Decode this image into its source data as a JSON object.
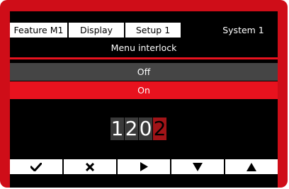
{
  "tabs": [
    {
      "label": "Feature  M1",
      "active": false
    },
    {
      "label": "Display",
      "active": false
    },
    {
      "label": "Setup 1",
      "active": false
    },
    {
      "label": "System 1",
      "active": true
    }
  ],
  "menu": {
    "title": "Menu interlock",
    "options": [
      {
        "label": "Off",
        "selected": false
      },
      {
        "label": "On",
        "selected": true
      }
    ]
  },
  "code": {
    "digits": [
      "1",
      "2",
      "0",
      "2"
    ],
    "selected_index": 3
  },
  "softkeys": [
    {
      "icon": "checkmark-icon"
    },
    {
      "icon": "close-icon"
    },
    {
      "icon": "arrow-right-icon"
    },
    {
      "icon": "arrow-down-icon"
    },
    {
      "icon": "arrow-up-icon"
    }
  ],
  "colors": {
    "frame_red": "#cf0d18",
    "accent_red": "#e8121e",
    "selected_digit_red": "#a11418",
    "option_gray": "#454545",
    "screen_black": "#000000"
  }
}
